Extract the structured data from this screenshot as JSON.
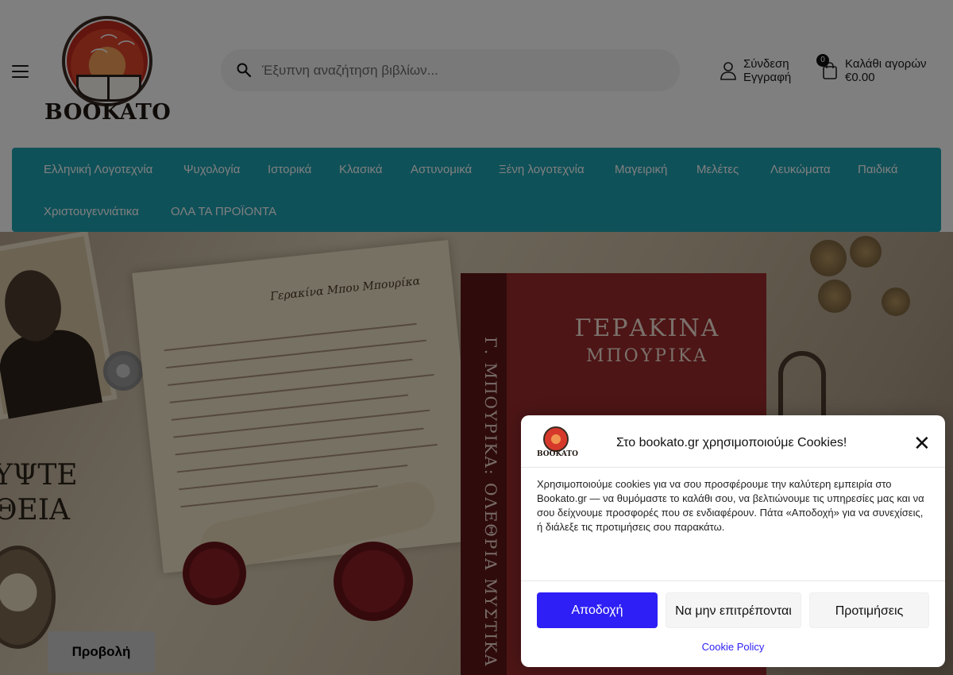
{
  "header": {
    "logo_text": "BOOKATO",
    "search": {
      "placeholder": "Έξυπνη αναζήτηση βιβλίων..."
    },
    "account": {
      "login_label": "Σύνδεση",
      "register_label": "Εγγραφή"
    },
    "cart": {
      "label": "Καλάθι αγορών",
      "total": "€0.00",
      "count": "0"
    }
  },
  "nav": {
    "items": [
      "Ελληνική Λογοτεχνία",
      "Ψυχολογία",
      "Ιστορικά",
      "Κλασικά",
      "Αστυνομικά",
      "Ξένη λογοτεχνία",
      "Μαγειρική",
      "Μελέτες",
      "Λευκώματα",
      "Παιδικά",
      "Χριστουγεννιάτικα",
      "ΟΛΑ ΤΑ ΠΡΟΪΟΝΤΑ"
    ],
    "color": "#1fa3b2"
  },
  "hero": {
    "letter_heading": "Γερακίνα Μπου Μπουρίκα",
    "book_title_line1": "ΓΕΡΑΚΙΝΑ",
    "book_title_line2": "ΜΠΟΥΡΙΚΑ",
    "spine_text": "Γ. ΜΠΟΥΡΙΚΑ: ΟΛΕΘΡΙΑ ΜΥΣΤΙΚΑ",
    "left_text_line1": "ΥΨΤΕ",
    "left_text_line2": "ΘΕΙΑ",
    "button_label": "Προβολή"
  },
  "cookie_dialog": {
    "logo_text": "BOOKATO",
    "title": "Στο bookato.gr χρησιμοποιούμε Cookies!",
    "message": "Χρησιμοποιούμε cookies για να σου προσφέρουμε την καλύτερη εμπειρία στο Bookato.gr — να θυμόμαστε το καλάθι σου, να βελτιώνουμε τις υπηρεσίες μας και να σου δείχνουμε προσφορές που σε ενδιαφέρουν. Πάτα «Αποδοχή» για να συνεχίσεις, ή διάλεξε τις προτιμήσεις σου παρακάτω.",
    "accept_label": "Αποδοχή",
    "deny_label": "Να μην επιτρέπονται",
    "preferences_label": "Προτιμήσεις",
    "policy_link": "Cookie Policy",
    "accent_color": "#2d1ff5"
  }
}
